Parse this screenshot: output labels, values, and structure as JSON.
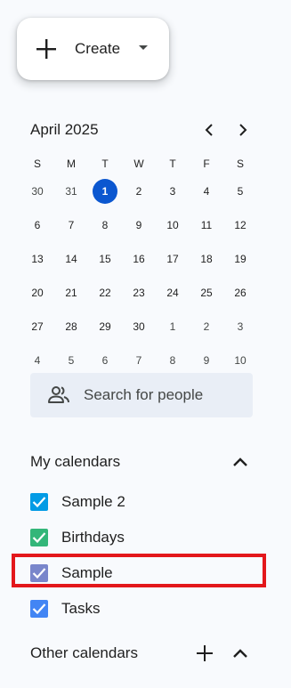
{
  "create_button": {
    "label": "Create"
  },
  "mini_calendar": {
    "month_label": "April 2025",
    "weekday_headers": [
      "S",
      "M",
      "T",
      "W",
      "T",
      "F",
      "S"
    ],
    "weeks": [
      [
        "30",
        "31",
        "1",
        "2",
        "3",
        "4",
        "5"
      ],
      [
        "6",
        "7",
        "8",
        "9",
        "10",
        "11",
        "12"
      ],
      [
        "13",
        "14",
        "15",
        "16",
        "17",
        "18",
        "19"
      ],
      [
        "20",
        "21",
        "22",
        "23",
        "24",
        "25",
        "26"
      ],
      [
        "27",
        "28",
        "29",
        "30",
        "1",
        "2",
        "3"
      ],
      [
        "4",
        "5",
        "6",
        "7",
        "8",
        "9",
        "10"
      ]
    ],
    "today": "1",
    "today_color": "#0b57d0"
  },
  "search_people": {
    "placeholder": "Search for people",
    "icon": "people-icon"
  },
  "my_calendars": {
    "title": "My calendars",
    "items": [
      {
        "label": "Sample 2",
        "color": "#039be5",
        "checked": true
      },
      {
        "label": "Birthdays",
        "color": "#33b679",
        "checked": true
      },
      {
        "label": "Sample",
        "color": "#7986cb",
        "checked": true
      },
      {
        "label": "Tasks",
        "color": "#4285f4",
        "checked": true
      }
    ]
  },
  "other_calendars": {
    "title": "Other calendars"
  },
  "highlight_color": "#e3171b"
}
